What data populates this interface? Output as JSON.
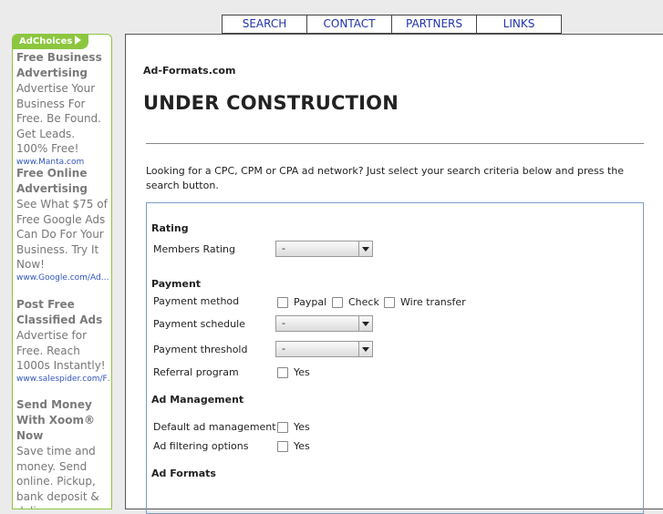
{
  "nav": {
    "items": [
      "SEARCH",
      "CONTACT",
      "PARTNERS",
      "LINKS"
    ]
  },
  "ads": {
    "adchoices_label": "AdChoices",
    "items": [
      {
        "title": "Free Business Advertising",
        "desc": "Advertise Your Business For Free. Be Found. Get Leads. 100% Free!",
        "url": "www.Manta.com"
      },
      {
        "title": "Free Online Advertising",
        "desc": "See What $75 of Free Google Ads Can Do For Your Business. Try It Now!",
        "url": "www.Google.com/Ad…"
      },
      {
        "title": "Post Free Classified Ads",
        "desc": "Advertise for Free. Reach 1000s Instantly!",
        "url": "www.salespider.com/F…"
      },
      {
        "title": "Send Money With Xoom® Now",
        "desc": "Save time and money. Send online. Pickup, bank deposit & delivery",
        "url": ""
      }
    ]
  },
  "main": {
    "site_name": "Ad-Formats.com",
    "title": "UNDER CONSTRUCTION",
    "intro": "Looking for a CPC, CPM or CPA ad network? Just select your search criteria below and press the search button."
  },
  "form": {
    "rating": {
      "heading": "Rating",
      "members_rating_label": "Members Rating",
      "members_rating_value": "-"
    },
    "payment": {
      "heading": "Payment",
      "method_label": "Payment method",
      "method_options": [
        "Paypal",
        "Check",
        "Wire transfer"
      ],
      "schedule_label": "Payment schedule",
      "schedule_value": "-",
      "threshold_label": "Payment threshold",
      "threshold_value": "-",
      "referral_label": "Referral program",
      "referral_option": "Yes"
    },
    "ad_management": {
      "heading": "Ad Management",
      "default_label": "Default ad management",
      "default_option": "Yes",
      "filtering_label": "Ad filtering options",
      "filtering_option": "Yes"
    },
    "ad_formats": {
      "heading": "Ad Formats"
    }
  }
}
